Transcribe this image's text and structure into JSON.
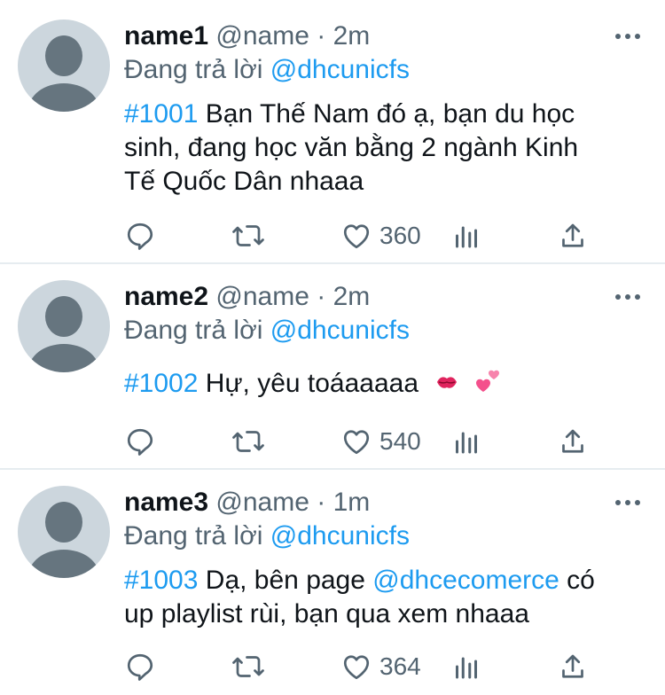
{
  "tweets": [
    {
      "name": "name1",
      "handle": "@name",
      "sep": "·",
      "time": "2m",
      "reply_prefix": "Đang trả lời",
      "reply_to": "@dhcunicfs",
      "hashtag": "#1001",
      "lines": [
        "Bạn Thế Nam đó ạ, bạn du học",
        "sinh, đang học văn bằng 2 ngành Kinh",
        "Tế Quốc Dân nhaaa"
      ],
      "likes": "360"
    },
    {
      "name": "name2",
      "handle": "@name",
      "sep": "·",
      "time": "2m",
      "reply_prefix": "Đang trả lời",
      "reply_to": "@dhcunicfs",
      "hashtag": "#1002",
      "text": "Hự, yêu toáaaaaa",
      "emojis": [
        "kiss-mark-emoji",
        "two-hearts-emoji"
      ],
      "likes": "540"
    },
    {
      "name": "name3",
      "handle": "@name",
      "sep": "·",
      "time": "1m",
      "reply_prefix": "Đang trả lời",
      "reply_to": "@dhcunicfs",
      "hashtag": "#1003",
      "text_before": "Dạ, bên page",
      "mention": "@dhcecomerce",
      "text_after": "có",
      "line2": "up playlist rùi, bạn qua xem nhaaa",
      "likes": "364"
    }
  ],
  "icons": [
    "more-icon",
    "reply-icon",
    "retweet-icon",
    "like-icon",
    "analytics-icon",
    "share-icon"
  ],
  "colors": {
    "link": "#1d9bf0",
    "secondary": "#536471",
    "divider": "#e6ecf0",
    "avatar_bg": "#ccd6dd",
    "avatar_fg": "#66757f"
  }
}
